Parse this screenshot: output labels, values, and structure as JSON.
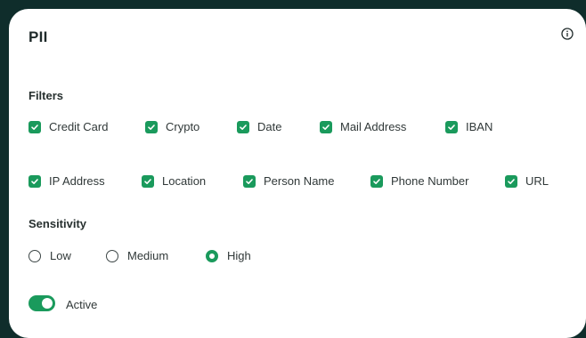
{
  "panel": {
    "title": "PII"
  },
  "filters": {
    "label": "Filters",
    "row1": [
      {
        "label": "Credit Card",
        "checked": true
      },
      {
        "label": "Crypto",
        "checked": true
      },
      {
        "label": "Date",
        "checked": true
      },
      {
        "label": "Mail Address",
        "checked": true
      },
      {
        "label": "IBAN",
        "checked": true
      }
    ],
    "row2": [
      {
        "label": "IP Address",
        "checked": true
      },
      {
        "label": "Location",
        "checked": true
      },
      {
        "label": "Person Name",
        "checked": true
      },
      {
        "label": "Phone Number",
        "checked": true
      },
      {
        "label": "URL",
        "checked": true
      }
    ]
  },
  "sensitivity": {
    "label": "Sensitivity",
    "options": [
      {
        "label": "Low",
        "selected": false
      },
      {
        "label": "Medium",
        "selected": false
      },
      {
        "label": "High",
        "selected": true
      }
    ]
  },
  "active": {
    "label": "Active",
    "on": true
  },
  "colors": {
    "accent": "#1a9a5c",
    "background": "#0f2d2b",
    "card": "#ffffff"
  },
  "icons": {
    "info": "info-icon",
    "check": "check-icon"
  }
}
